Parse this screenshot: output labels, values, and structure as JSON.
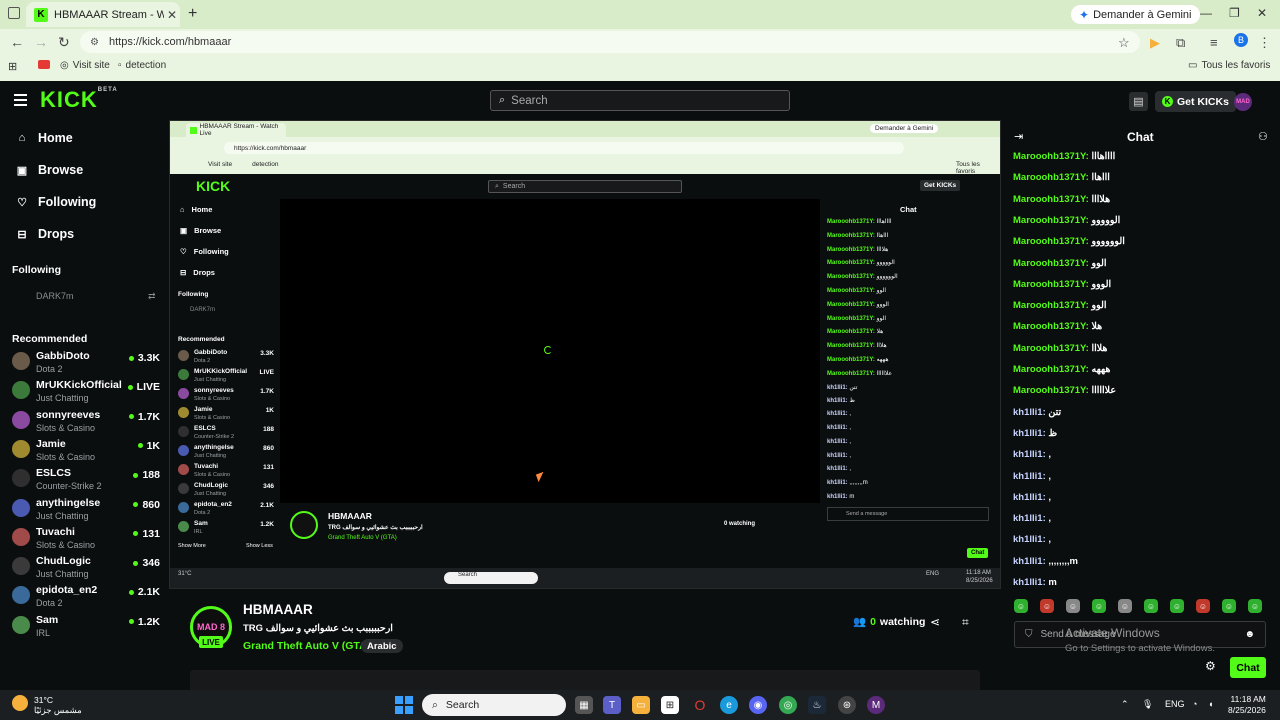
{
  "browser": {
    "tab_title": "HBMAAAR Stream - Watch Live",
    "gemini_label": "Demander à Gemini",
    "url": "https://kick.com/hbmaaar",
    "bookmarks": [
      "Visit site",
      "detection"
    ],
    "all_bookmarks": "Tous les favoris"
  },
  "site": {
    "search_placeholder": "Search",
    "get_kicks": "Get KICKs",
    "nav": [
      "Home",
      "Browse",
      "Following",
      "Drops"
    ],
    "following_header": "Following",
    "following_user": "DARK7m",
    "recommended_header": "Recommended",
    "recommended": [
      {
        "name": "GabbiDoto",
        "game": "Dota 2",
        "viewers": "3.3K",
        "color": "#6a5a4a"
      },
      {
        "name": "MrUKKickOfficial",
        "game": "Just Chatting",
        "viewers": "LIVE",
        "color": "#3c7a3c"
      },
      {
        "name": "sonnyreeves",
        "game": "Slots & Casino",
        "viewers": "1.7K",
        "color": "#8a4aa0"
      },
      {
        "name": "Jamie",
        "game": "Slots & Casino",
        "viewers": "1K",
        "color": "#a08a30"
      },
      {
        "name": "ESLCS",
        "game": "Counter-Strike 2",
        "viewers": "188",
        "color": "#2f2f2f"
      },
      {
        "name": "anythingelse",
        "game": "Just Chatting",
        "viewers": "860",
        "color": "#4a5ab0"
      },
      {
        "name": "Tuvachi",
        "game": "Slots & Casino",
        "viewers": "131",
        "color": "#a04a4a"
      },
      {
        "name": "ChudLogic",
        "game": "Just Chatting",
        "viewers": "346",
        "color": "#3a3a3a"
      },
      {
        "name": "epidota_en2",
        "game": "Dota 2",
        "viewers": "2.1K",
        "color": "#3a6a9a"
      },
      {
        "name": "Sam",
        "game": "IRL",
        "viewers": "1.2K",
        "color": "#4a8a4a"
      }
    ],
    "show_more": "Show More",
    "show_less": "Show Less"
  },
  "stream": {
    "streamer": "HBMAAAR",
    "avatar_text": "MAD 8",
    "live_badge": "LIVE",
    "title": "TRG ارحبببببب بث عشوائيي و سوالف",
    "category": "Grand Theft Auto V (GTA)",
    "language": "Arabic",
    "watching_count": "0",
    "watching_label": "watching"
  },
  "chat": {
    "title": "Chat",
    "messages": [
      {
        "user": "Marooohb1371Y:",
        "text": "ااااهااا",
        "kind": "a"
      },
      {
        "user": "Marooohb1371Y:",
        "text": "اااهاا",
        "kind": "a"
      },
      {
        "user": "Marooohb1371Y:",
        "text": "هلاااا",
        "kind": "a"
      },
      {
        "user": "Marooohb1371Y:",
        "text": "الووووو",
        "kind": "a"
      },
      {
        "user": "Marooohb1371Y:",
        "text": "الوووووو",
        "kind": "a"
      },
      {
        "user": "Marooohb1371Y:",
        "text": "الوو",
        "kind": "a"
      },
      {
        "user": "Marooohb1371Y:",
        "text": "الووو",
        "kind": "a"
      },
      {
        "user": "Marooohb1371Y:",
        "text": "الوو",
        "kind": "a"
      },
      {
        "user": "Marooohb1371Y:",
        "text": "هلا",
        "kind": "a"
      },
      {
        "user": "Marooohb1371Y:",
        "text": "هلااا",
        "kind": "a"
      },
      {
        "user": "Marooohb1371Y:",
        "text": "هههه",
        "kind": "a"
      },
      {
        "user": "Marooohb1371Y:",
        "text": "علاااااا",
        "kind": "a"
      },
      {
        "user": "kh1lli1:",
        "text": "تتن",
        "kind": "b"
      },
      {
        "user": "kh1lli1:",
        "text": "ظ",
        "kind": "b"
      },
      {
        "user": "kh1lli1:",
        "text": ",",
        "kind": "b"
      },
      {
        "user": "kh1lli1:",
        "text": ",",
        "kind": "b"
      },
      {
        "user": "kh1lli1:",
        "text": ",",
        "kind": "b"
      },
      {
        "user": "kh1lli1:",
        "text": ",",
        "kind": "b"
      },
      {
        "user": "kh1lli1:",
        "text": ",",
        "kind": "b"
      },
      {
        "user": "kh1lli1:",
        "text": ",,,,,,,,m",
        "kind": "b"
      },
      {
        "user": "kh1lli1:",
        "text": "m",
        "kind": "b"
      }
    ],
    "input_placeholder": "Send a message",
    "send_button": "Chat",
    "activate_title": "Activate Windows",
    "activate_sub": "Go to Settings to activate Windows."
  },
  "taskbar": {
    "temp": "31°C",
    "weather_desc": "مشمس جزئيًا",
    "search": "Search",
    "lang": "ENG",
    "time": "11:18 AM",
    "date": "8/25/2026"
  },
  "colors": {
    "accent": "#53fc18",
    "background": "#0b0e0f"
  }
}
